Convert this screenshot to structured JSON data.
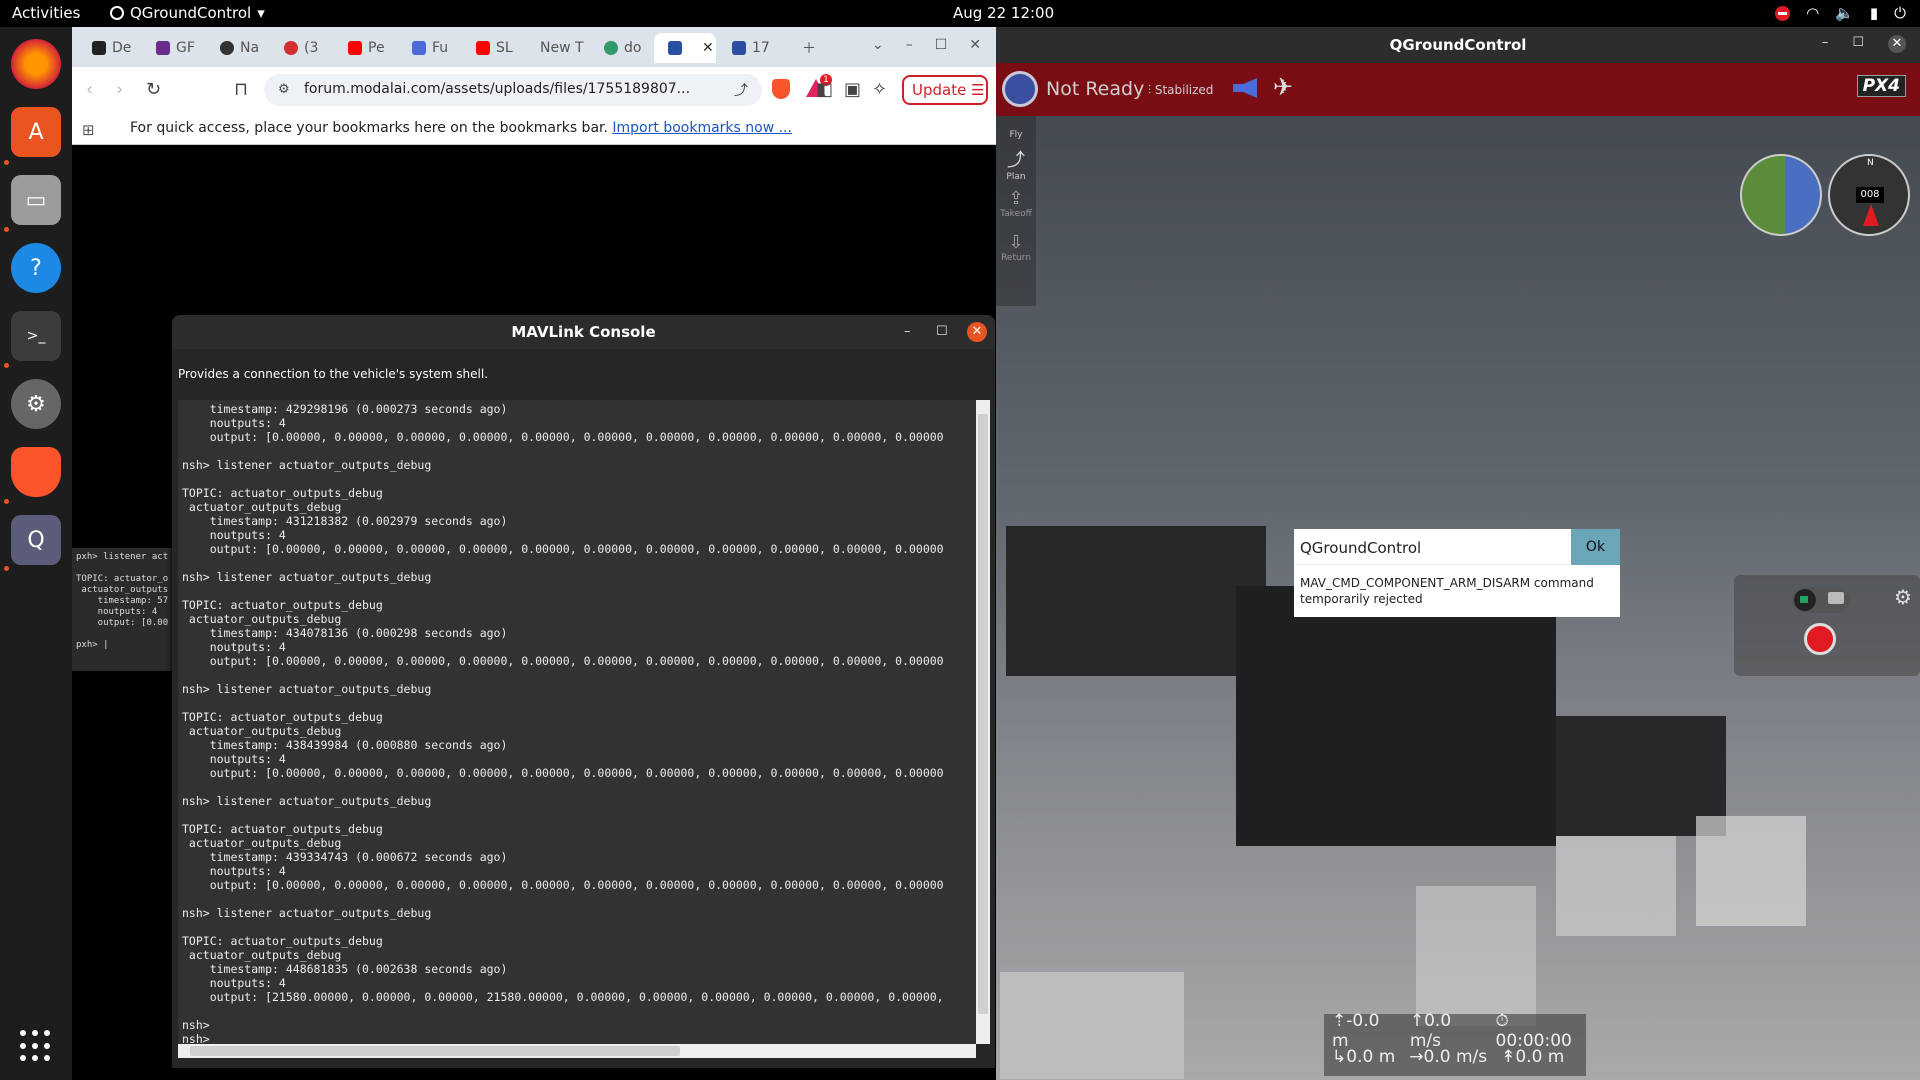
{
  "topbar": {
    "activities": "Activities",
    "app_name": "QGroundControl",
    "clock": "Aug 22  12:00"
  },
  "dock": {
    "items": [
      "firefox-icon",
      "app-center-icon",
      "files-icon",
      "help-icon",
      "terminal-icon",
      "settings-icon",
      "brave-icon",
      "qgroundcontrol-icon"
    ]
  },
  "browser": {
    "tabs": [
      {
        "label": "De"
      },
      {
        "label": "GF"
      },
      {
        "label": "Na"
      },
      {
        "label": "(3"
      },
      {
        "label": "Pe"
      },
      {
        "label": "Fu"
      },
      {
        "label": "SL"
      },
      {
        "label": "New T"
      },
      {
        "label": "do"
      },
      {
        "label": ""
      },
      {
        "label": "17"
      }
    ],
    "url": "forum.modalai.com/assets/uploads/files/1755189807...",
    "update_label": "Update",
    "rewards_count": "1",
    "bookmarks_msg": "For quick access, place your bookmarks here on the bookmarks bar.",
    "bookmarks_link": "Import bookmarks now ..."
  },
  "term_peek": {
    "text": "pxh> listener act\n\nTOPIC: actuator_o\n actuator_outputs\n    timestamp: 57\n    noutputs: 4\n    output: [0.00\n\npxh> |"
  },
  "console": {
    "title": "MAVLink Console",
    "description": "Provides a connection to the vehicle's system shell.",
    "log": "    timestamp: 429298196 (0.000273 seconds ago)\n    noutputs: 4\n    output: [0.00000, 0.00000, 0.00000, 0.00000, 0.00000, 0.00000, 0.00000, 0.00000, 0.00000, 0.00000, 0.00000\n\nnsh> listener actuator_outputs_debug\n\nTOPIC: actuator_outputs_debug\n actuator_outputs_debug\n    timestamp: 431218382 (0.002979 seconds ago)\n    noutputs: 4\n    output: [0.00000, 0.00000, 0.00000, 0.00000, 0.00000, 0.00000, 0.00000, 0.00000, 0.00000, 0.00000, 0.00000\n\nnsh> listener actuator_outputs_debug\n\nTOPIC: actuator_outputs_debug\n actuator_outputs_debug\n    timestamp: 434078136 (0.000298 seconds ago)\n    noutputs: 4\n    output: [0.00000, 0.00000, 0.00000, 0.00000, 0.00000, 0.00000, 0.00000, 0.00000, 0.00000, 0.00000, 0.00000\n\nnsh> listener actuator_outputs_debug\n\nTOPIC: actuator_outputs_debug\n actuator_outputs_debug\n    timestamp: 438439984 (0.000880 seconds ago)\n    noutputs: 4\n    output: [0.00000, 0.00000, 0.00000, 0.00000, 0.00000, 0.00000, 0.00000, 0.00000, 0.00000, 0.00000, 0.00000\n\nnsh> listener actuator_outputs_debug\n\nTOPIC: actuator_outputs_debug\n actuator_outputs_debug\n    timestamp: 439334743 (0.000672 seconds ago)\n    noutputs: 4\n    output: [0.00000, 0.00000, 0.00000, 0.00000, 0.00000, 0.00000, 0.00000, 0.00000, 0.00000, 0.00000, 0.00000\n\nnsh> listener actuator_outputs_debug\n\nTOPIC: actuator_outputs_debug\n actuator_outputs_debug\n    timestamp: 448681835 (0.002638 seconds ago)\n    noutputs: 4\n    output: [21580.00000, 0.00000, 0.00000, 21580.00000, 0.00000, 0.00000, 0.00000, 0.00000, 0.00000, 0.00000,\n\nnsh>\nnsh>"
  },
  "qgc": {
    "window_title": "QGroundControl",
    "status": "Not Ready",
    "flight_mode": "Stabilized",
    "px4_label": "PX4",
    "tools": [
      {
        "label": "Fly",
        "icon": ""
      },
      {
        "label": "Plan",
        "icon": "⤴"
      },
      {
        "label": "Takeoff",
        "icon": "⇪"
      },
      {
        "label": "Return",
        "icon": "⇩"
      }
    ],
    "compass_heading": "008",
    "compass_n": "N",
    "dialog": {
      "title": "QGroundControl",
      "ok": "Ok",
      "message": "MAV_CMD_COMPONENT_ARM_DISARM command temporarily rejected"
    },
    "telemetry": {
      "altitude_rel": "-0.0 m",
      "vspeed": "0.0 m/s",
      "flight_time": "00:00:00",
      "distance": "0.0 m",
      "hspeed": "0.0 m/s",
      "altitude_amsl": "0.0 m"
    }
  }
}
